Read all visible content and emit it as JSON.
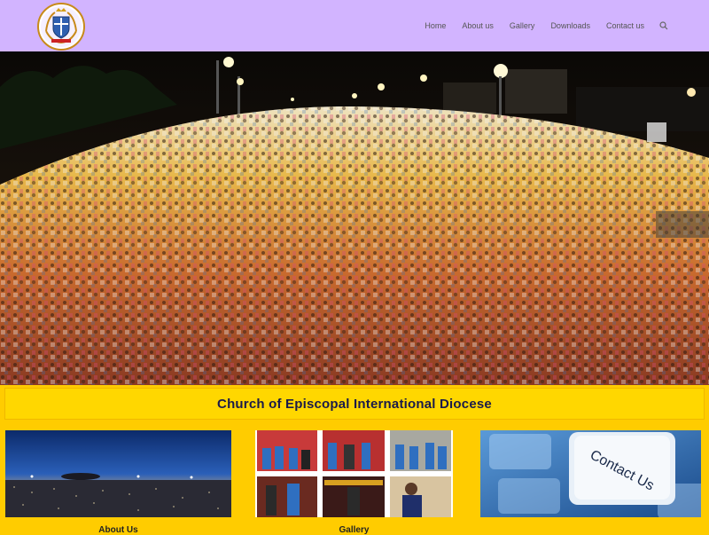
{
  "header": {
    "logo_name": "diocese-crest",
    "nav": [
      {
        "label": "Home"
      },
      {
        "label": "About us"
      },
      {
        "label": "Gallery"
      },
      {
        "label": "Downloads"
      },
      {
        "label": "Contact us"
      }
    ],
    "search_icon": "search-icon"
  },
  "hero": {
    "description_icon": "crowd-photo"
  },
  "title": {
    "text": "Church of Episcopal International Diocese"
  },
  "cards": [
    {
      "label": "About Us"
    },
    {
      "label": "Gallery"
    },
    {
      "label": "",
      "image_text": "Contact Us"
    }
  ],
  "colors": {
    "header_bg": "#d2b4ff",
    "page_bg": "#ffcc00",
    "title_bar": "#ffd700",
    "title_text": "#1a1a4a"
  }
}
